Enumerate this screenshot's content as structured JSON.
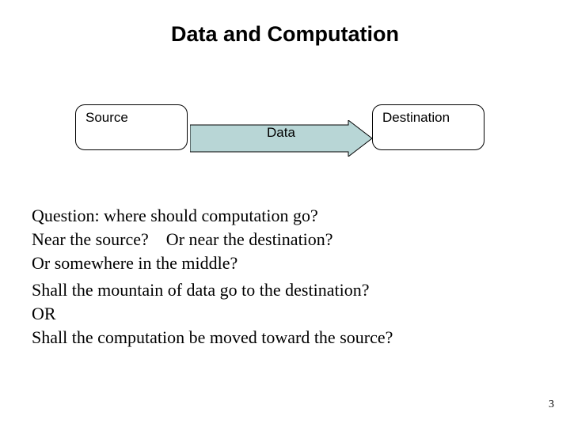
{
  "title": "Data and Computation",
  "diagram": {
    "source_label": "Source",
    "arrow_label": "Data",
    "destination_label": "Destination",
    "arrow_fill": "#b8d6d6",
    "arrow_stroke": "#000000"
  },
  "paragraphs": {
    "p1_line1": "Question: where should computation go?",
    "p1_line2": "Near the source?    Or near the destination?",
    "p1_line3": "Or somewhere in the middle?",
    "p2_line1": "Shall the mountain of data go to the destination?",
    "p2_line2": "OR",
    "p2_line3": "Shall the computation be moved toward the source?"
  },
  "page_number": "3"
}
